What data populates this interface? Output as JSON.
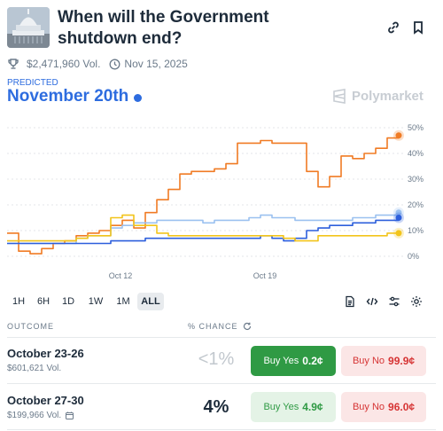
{
  "market": {
    "title": "When will the Government shutdown end?",
    "volume": "$2,471,960 Vol.",
    "date": "Nov 15, 2025"
  },
  "predicted": {
    "label": "PREDICTED",
    "value": "November 20th"
  },
  "brand": "Polymarket",
  "chart_data": {
    "type": "line",
    "x_ticks": [
      "Oct 12",
      "Oct 19"
    ],
    "y_ticks": [
      "50%",
      "40%",
      "30%",
      "20%",
      "10%",
      "0%"
    ],
    "ylim": [
      0,
      50
    ],
    "grid": "horizontal dashed",
    "series": [
      {
        "color": "#f07b24",
        "values": [
          9,
          2,
          1,
          3,
          5,
          6,
          8,
          9,
          10,
          12,
          14,
          11,
          17,
          22,
          26,
          32,
          33,
          33,
          34,
          36,
          44,
          44,
          45,
          44,
          44,
          44,
          33,
          27,
          31,
          39,
          38,
          40,
          42,
          46,
          47
        ]
      },
      {
        "color": "#9bc1f0",
        "values": [
          5,
          5,
          5,
          5,
          5,
          5,
          7,
          8,
          8,
          11,
          12,
          13,
          13,
          14,
          14,
          14,
          14,
          13,
          14,
          14,
          14,
          15,
          16,
          15,
          15,
          14,
          14,
          14,
          14,
          14,
          15,
          15,
          16,
          16,
          17
        ]
      },
      {
        "color": "#2d5fdc",
        "values": [
          5,
          5,
          5,
          5,
          5,
          5,
          5,
          5,
          5,
          6,
          6,
          6,
          7,
          7,
          7,
          7,
          7,
          7,
          7,
          7,
          7,
          7,
          8,
          7,
          6,
          7,
          10,
          11,
          12,
          12,
          13,
          13,
          14,
          14,
          15
        ]
      },
      {
        "color": "#f2c41b",
        "values": [
          6,
          6,
          6,
          6,
          6,
          6,
          7,
          8,
          8,
          15,
          16,
          12,
          12,
          9,
          8,
          8,
          8,
          8,
          8,
          8,
          8,
          8,
          8,
          8,
          7,
          6,
          6,
          8,
          8,
          8,
          8,
          8,
          8,
          9,
          9
        ]
      }
    ]
  },
  "timeframes": [
    "1H",
    "6H",
    "1D",
    "1W",
    "1M",
    "ALL"
  ],
  "table": {
    "col_outcome": "OUTCOME",
    "col_chance": "% CHANCE",
    "rows": [
      {
        "name": "October 23-26",
        "volume": "$601,621 Vol.",
        "chance": "<1%",
        "yes_label": "Buy Yes",
        "yes_price": "0.2¢",
        "no_label": "Buy No",
        "no_price": "99.9¢"
      },
      {
        "name": "October 27-30",
        "volume": "$199,966 Vol.",
        "chance": "4%",
        "yes_label": "Buy Yes",
        "yes_price": "4.9¢",
        "no_label": "Buy No",
        "no_price": "96.0¢"
      }
    ]
  },
  "colors": {
    "accent": "#2d6cdf",
    "yes": "#2f9a44",
    "no": "#d63434"
  },
  "icons": [
    "link-icon",
    "bookmark-icon",
    "trophy-icon",
    "clock-icon",
    "document-icon",
    "code-icon",
    "sliders-icon",
    "gear-icon",
    "refresh-icon",
    "calendar-icon"
  ]
}
